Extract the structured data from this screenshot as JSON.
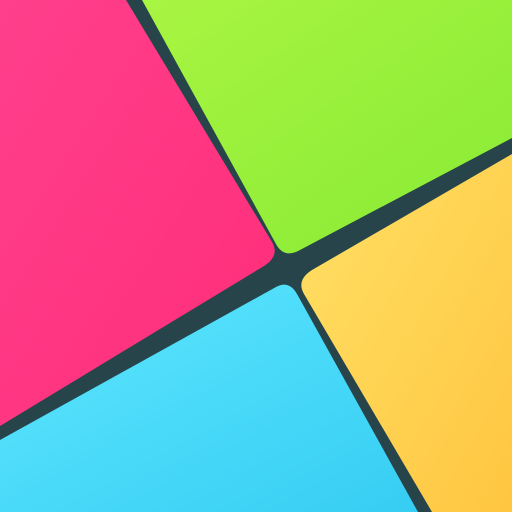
{
  "background_color": "#26444a",
  "tiles": [
    {
      "name": "pink-tile",
      "colors": [
        "#ff3f8c",
        "#ff2d79"
      ],
      "interactable": true
    },
    {
      "name": "green-tile",
      "colors": [
        "#a8f542",
        "#88ea34"
      ],
      "interactable": true
    },
    {
      "name": "yellow-tile",
      "colors": [
        "#ffe066",
        "#ffc640"
      ],
      "interactable": true
    },
    {
      "name": "blue-tile",
      "colors": [
        "#5ee7ff",
        "#36cdf3"
      ],
      "interactable": true
    }
  ]
}
